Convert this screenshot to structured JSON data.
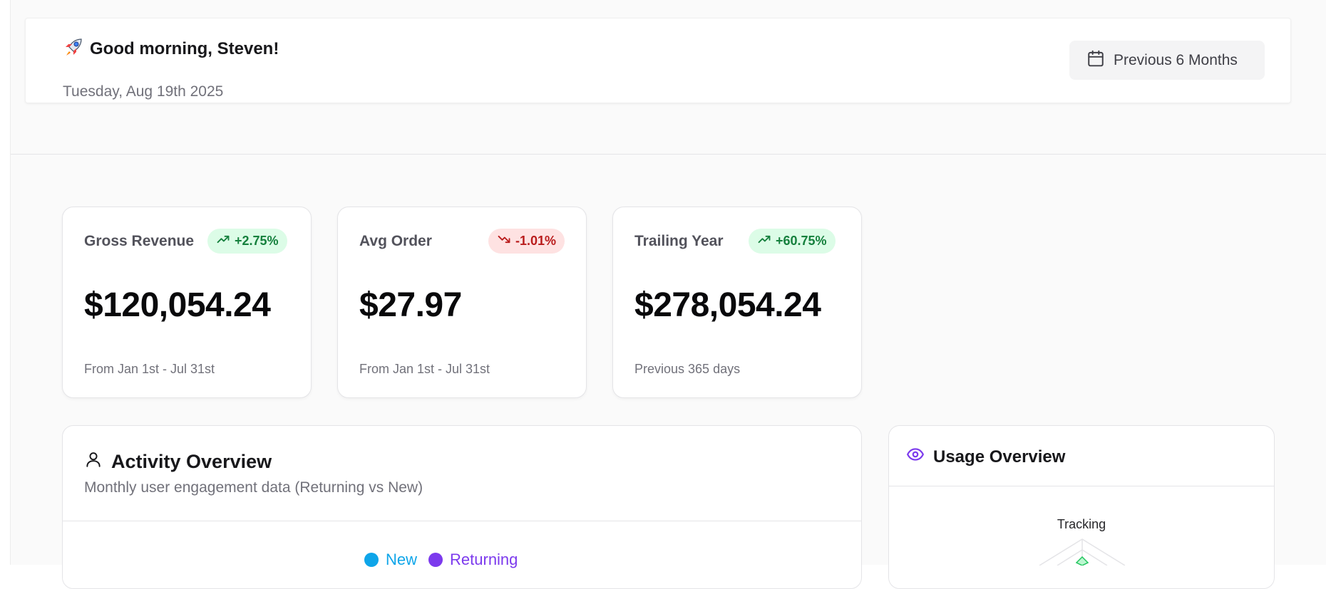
{
  "header": {
    "greeting": "Good morning, Steven!",
    "date": "Tuesday, Aug 19th 2025",
    "range_button": "Previous 6 Months"
  },
  "stats": [
    {
      "label": "Gross Revenue",
      "change": "+2.75%",
      "trend": "up",
      "value": "$120,054.24",
      "note": "From Jan 1st - Jul 31st"
    },
    {
      "label": "Avg Order",
      "change": "-1.01%",
      "trend": "down",
      "value": "$27.97",
      "note": "From Jan 1st - Jul 31st"
    },
    {
      "label": "Trailing Year",
      "change": "+60.75%",
      "trend": "up",
      "value": "$278,054.24",
      "note": "Previous 365 days"
    }
  ],
  "activity": {
    "title": "Activity Overview",
    "subtitle": "Monthly user engagement data (Returning vs New)",
    "legend": [
      {
        "name": "New",
        "color": "#0ea5e9"
      },
      {
        "name": "Returning",
        "color": "#7c3aed"
      }
    ]
  },
  "usage": {
    "title": "Usage Overview",
    "radar_axis_top": "Tracking",
    "accent": "#7c3aed"
  },
  "colors": {
    "positive_bg": "#dcfce7",
    "positive_text": "#15803d",
    "negative_bg": "#fee2e2",
    "negative_text": "#b91c1c"
  }
}
